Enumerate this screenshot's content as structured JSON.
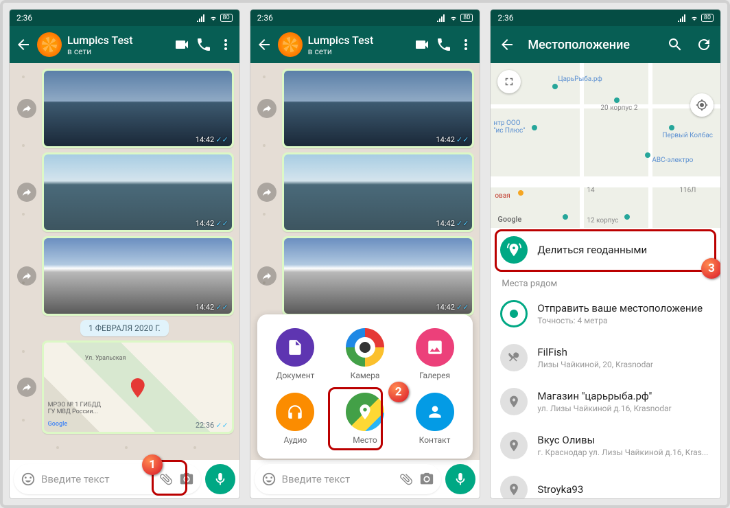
{
  "statusbar": {
    "time": "2:36",
    "battery": "80"
  },
  "header": {
    "contact": "Lumpics Test",
    "status": "в сети"
  },
  "messages": {
    "times": [
      "14:42",
      "14:42",
      "14:42"
    ],
    "date_pill": "1 ФЕВРАЛЯ 2020 Г.",
    "map_time": "22:36",
    "map_label1": "Ул. Уральская",
    "map_label2": "МРЭО № 1 ГИБДД\nГУ МВД России...",
    "map_brand": "Google"
  },
  "input": {
    "placeholder": "Введите текст"
  },
  "attach": {
    "document": "Документ",
    "camera": "Камера",
    "gallery": "Галерея",
    "audio": "Аудио",
    "location": "Место",
    "contact": "Контакт"
  },
  "loc": {
    "title": "Местоположение",
    "share": "Делиться геоданными",
    "nearby_header": "Места рядом",
    "send_current": "Отправить ваше местоположение",
    "accuracy": "Точность: 4 метра",
    "places": [
      {
        "name": "FilFish",
        "addr": "Лизы Чайкиной, 20, Krasnodar"
      },
      {
        "name": "Магазин \"царьрыба.рф\"",
        "addr": "ул. Лизы Чайкиной д.16, Krasnodar"
      },
      {
        "name": "Вкус Оливы",
        "addr": "г. Краснодар ул. Лизы Чайкиной д.16, Kras..."
      },
      {
        "name": "Stroyka93",
        "addr": ""
      }
    ],
    "map": {
      "brand": "Google",
      "labels": [
        "ЦарьРыба.рф",
        "20 корпус 2",
        "нтр ООО\n\"ис Плюс\"",
        "Первый Колбас",
        "АВС-электро",
        "овая",
        "14",
        "116Л",
        "12 корпус"
      ]
    }
  }
}
